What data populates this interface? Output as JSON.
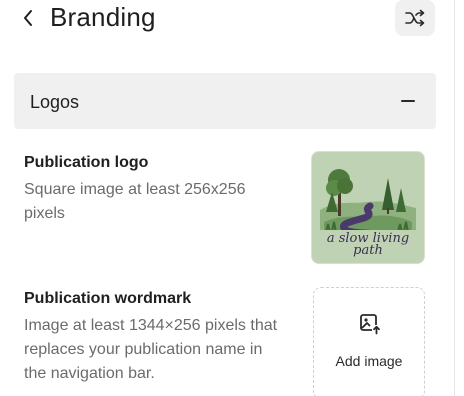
{
  "header": {
    "title": "Branding",
    "back_icon": "chevron-left-icon",
    "shuffle_icon": "shuffle-icon"
  },
  "section": {
    "title": "Logos",
    "collapse_icon": "minus-icon"
  },
  "publication_logo": {
    "title": "Publication logo",
    "description": "Square image at least 256x256 pixels",
    "image_text_line1": "a slow living",
    "image_text_line2": "path"
  },
  "publication_wordmark": {
    "title": "Publication wordmark",
    "description": "Image at least 1344×256 pixels that replaces your publication name in the navigation bar.",
    "add_label": "Add image",
    "add_icon": "image-upload-icon"
  },
  "colors": {
    "section_bg": "#f0f0f0",
    "text_primary": "#1f1f1f",
    "text_secondary": "#6b6b6b",
    "logo_bg": "#bfd3b4",
    "logo_path": "#4a3a6b"
  }
}
